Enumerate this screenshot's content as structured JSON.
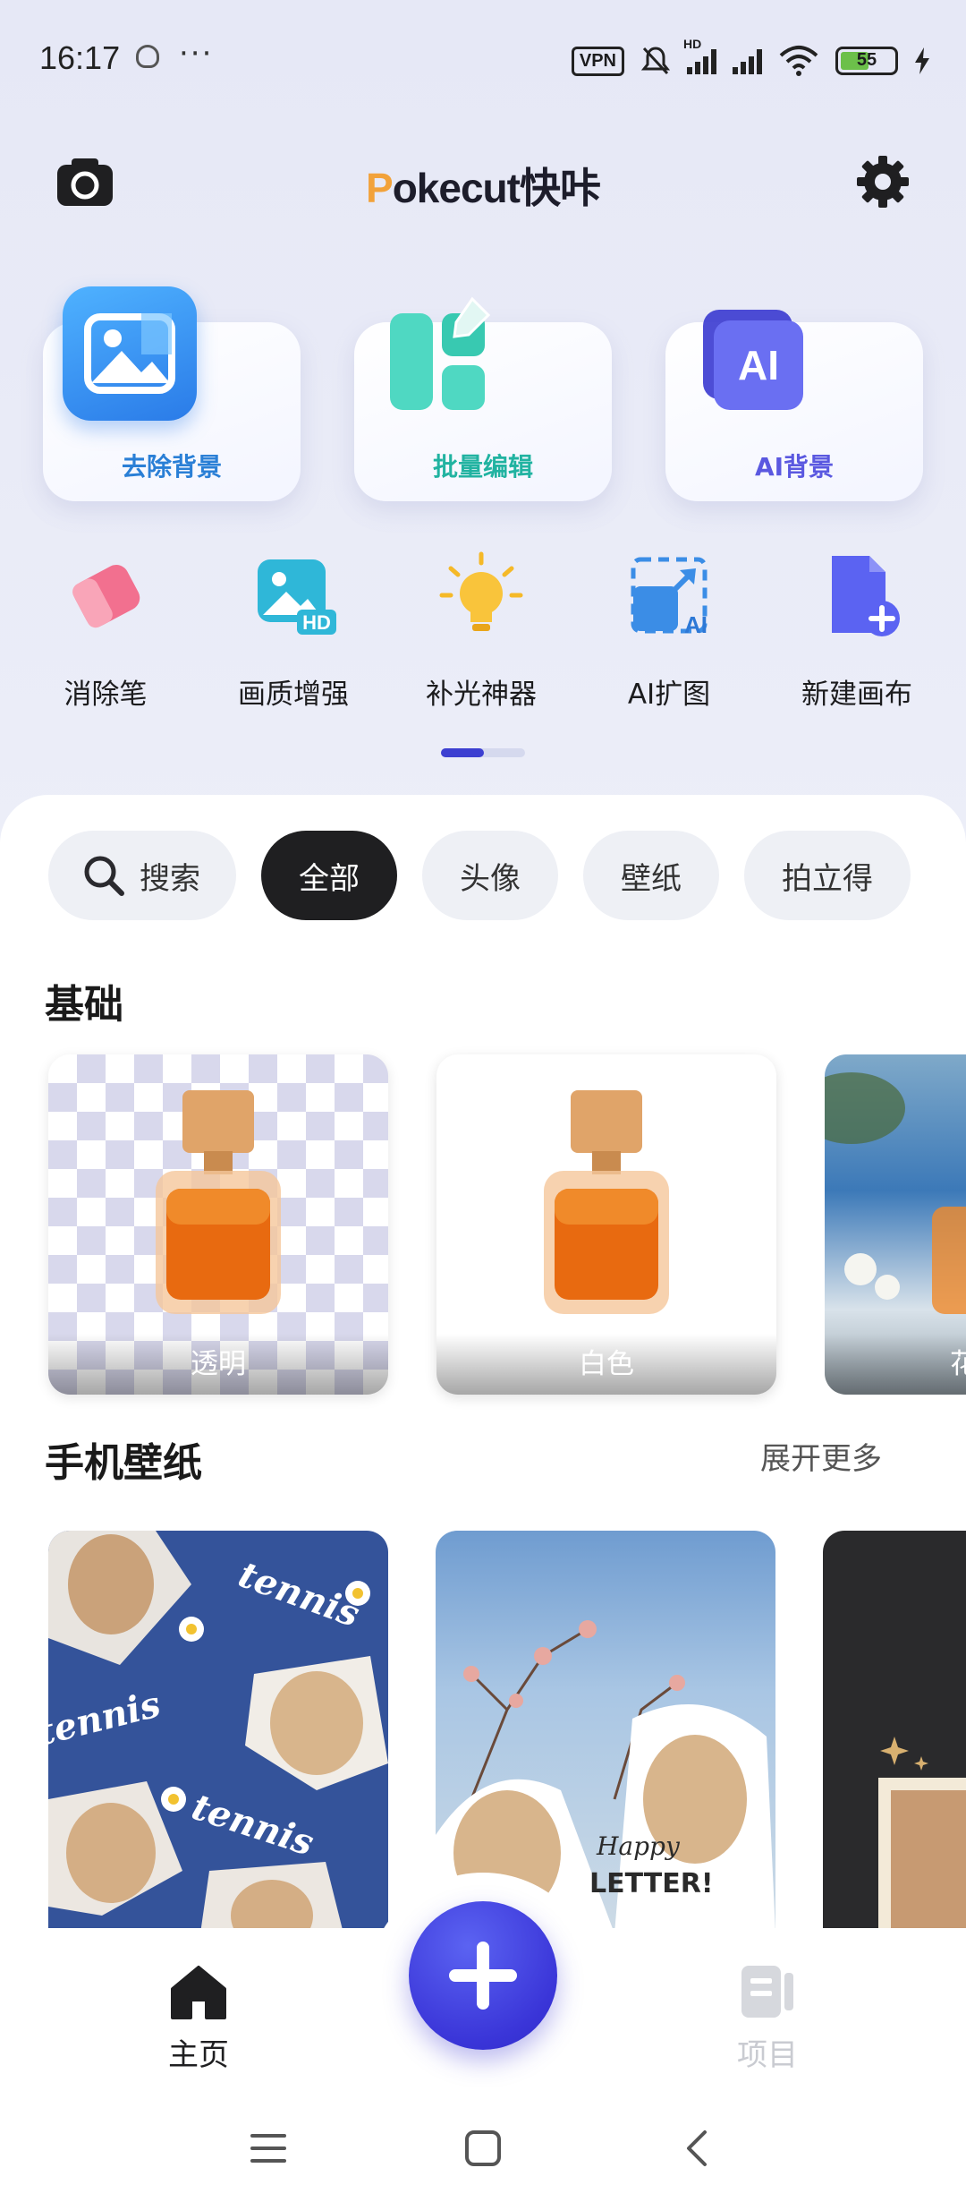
{
  "status_bar": {
    "time": "16:17",
    "dots": "···",
    "vpn": "VPN",
    "hd": "HD",
    "battery": "55"
  },
  "header": {
    "logo_first": "P",
    "logo_rest": "okecut快咔"
  },
  "feature_cards": [
    {
      "label": "去除背景",
      "color": "#2a7fd6"
    },
    {
      "label": "批量编辑",
      "color": "#21b3a1"
    },
    {
      "label": "AI背景",
      "color": "#5a58e0"
    }
  ],
  "tools": [
    {
      "label": "消除笔"
    },
    {
      "label": "画质增强"
    },
    {
      "label": "补光神器"
    },
    {
      "label": "AI扩图"
    },
    {
      "label": "新建画布"
    }
  ],
  "chips": {
    "search": "搜索",
    "items": [
      "全部",
      "头像",
      "壁纸",
      "拍立得"
    ],
    "active": "全部"
  },
  "sections": {
    "basic": {
      "title": "基础",
      "items": [
        {
          "label": "透明"
        },
        {
          "label": "白色"
        },
        {
          "label": "花"
        }
      ]
    },
    "wallpaper": {
      "title": "手机壁纸",
      "more": "展开更多",
      "texts": [
        "tennis",
        "tennis",
        "tennis",
        "Happy",
        "LETTER!"
      ]
    }
  },
  "bottom_nav": {
    "home": "主页",
    "projects": "项目"
  }
}
